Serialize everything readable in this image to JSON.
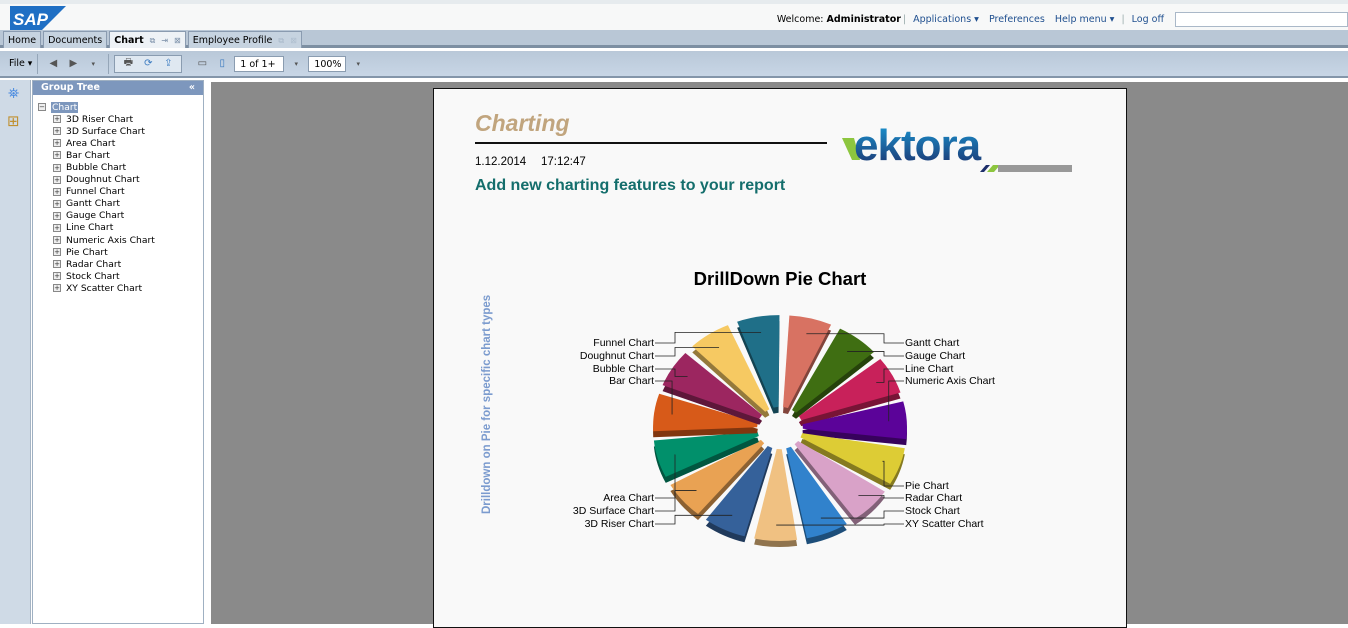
{
  "header": {
    "brand": "SAP",
    "welcome_prefix": "Welcome:",
    "user": "Administrator",
    "applications": "Applications",
    "preferences": "Preferences",
    "help_menu": "Help menu",
    "log_off": "Log off",
    "search_value": ""
  },
  "tabs": [
    {
      "label": "Home"
    },
    {
      "label": "Documents"
    },
    {
      "label": "Chart",
      "active": true
    },
    {
      "label": "Employee Profile"
    }
  ],
  "toolbar": {
    "file": "File",
    "page_value": "1 of 1+",
    "zoom_value": "100%"
  },
  "group_tree": {
    "title": "Group Tree",
    "root": "Chart",
    "items": [
      "3D Riser Chart",
      "3D Surface Chart",
      "Area Chart",
      "Bar Chart",
      "Bubble Chart",
      "Doughnut Chart",
      "Funnel Chart",
      "Gantt Chart",
      "Gauge Chart",
      "Line Chart",
      "Numeric Axis Chart",
      "Pie Chart",
      "Radar Chart",
      "Stock Chart",
      "XY Scatter Chart"
    ]
  },
  "report": {
    "title": "Charting",
    "date": "1.12.2014",
    "time": "17:12:47",
    "subtitle": "Add new charting features to your report",
    "logo": "vektora",
    "side_note": "Drilldown on Pie for specific chart types"
  },
  "chart_data": {
    "type": "pie",
    "style": "3d-exploded",
    "title": "DrillDown Pie Chart",
    "legend": "none",
    "labels_placement": "outside-with-leaders",
    "slices": [
      {
        "label": "Gantt Chart",
        "value": 1,
        "color": "#d87262"
      },
      {
        "label": "Gauge Chart",
        "value": 1,
        "color": "#3f6e12"
      },
      {
        "label": "Line Chart",
        "value": 1,
        "color": "#c8215a"
      },
      {
        "label": "Numeric Axis Chart",
        "value": 1,
        "color": "#5b0399"
      },
      {
        "label": "Pie Chart",
        "value": 1,
        "color": "#ddcc35"
      },
      {
        "label": "Radar Chart",
        "value": 1,
        "color": "#d9a2c8"
      },
      {
        "label": "Stock Chart",
        "value": 1,
        "color": "#3182cc"
      },
      {
        "label": "XY Scatter Chart",
        "value": 1,
        "color": "#f0c182"
      },
      {
        "label": "3D Riser Chart",
        "value": 1,
        "color": "#35619a"
      },
      {
        "label": "3D Surface Chart",
        "value": 1,
        "color": "#e9a253"
      },
      {
        "label": "Area Chart",
        "value": 1,
        "color": "#01906b"
      },
      {
        "label": "Bar Chart",
        "value": 1,
        "color": "#d75a19"
      },
      {
        "label": "Bubble Chart",
        "value": 1,
        "color": "#9c2660"
      },
      {
        "label": "Doughnut Chart",
        "value": 1,
        "color": "#f6c962"
      },
      {
        "label": "Funnel Chart",
        "value": 1,
        "color": "#1f6f88"
      }
    ]
  }
}
